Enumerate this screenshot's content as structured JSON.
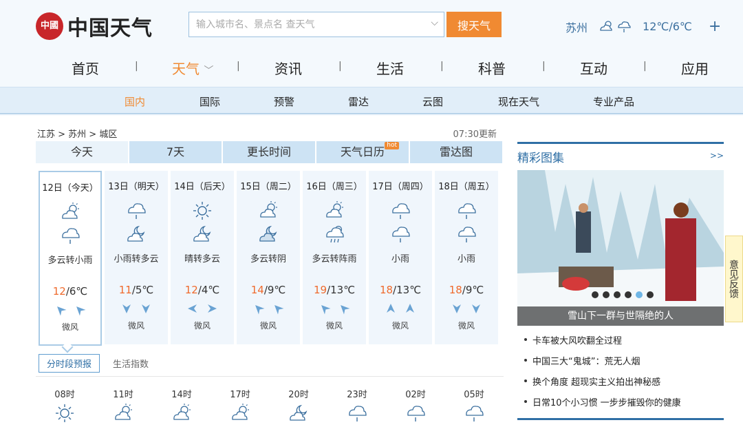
{
  "logo": {
    "seal": "中國",
    "text": "中国天气"
  },
  "search": {
    "placeholder": "输入城市名、景点名 查天气",
    "button": "搜天气"
  },
  "current": {
    "city": "苏州",
    "temp": "12℃/6℃",
    "plus": "+"
  },
  "mainnav": [
    "首页",
    "天气",
    "资讯",
    "生活",
    "科普",
    "互动",
    "应用"
  ],
  "mainnav_active": "天气",
  "subnav": [
    "国内",
    "国际",
    "预警",
    "雷达",
    "云图",
    "现在天气",
    "专业产品"
  ],
  "breadcrumb": "江苏 > 苏州 > 城区",
  "updated": "07:30更新",
  "tabs": [
    {
      "label": "今天"
    },
    {
      "label": "7天"
    },
    {
      "label": "更长时间"
    },
    {
      "label": "天气日历",
      "badge": "hot"
    },
    {
      "label": "雷达图"
    }
  ],
  "days": [
    {
      "date": "12日（今天）",
      "desc": "多云转小雨",
      "hi": "12",
      "lo": "/6℃",
      "wind": "微风",
      "icons": [
        "partly-cloudy-icon",
        "rain-icon"
      ]
    },
    {
      "date": "13日（明天）",
      "desc": "小雨转多云",
      "hi": "11",
      "lo": "/5℃",
      "wind": "微风",
      "icons": [
        "rain-icon",
        "partly-cloudy-night-icon"
      ]
    },
    {
      "date": "14日（后天）",
      "desc": "晴转多云",
      "hi": "12",
      "lo": "/4℃",
      "wind": "微风",
      "icons": [
        "sun-icon",
        "partly-cloudy-night-icon"
      ]
    },
    {
      "date": "15日（周二）",
      "desc": "多云转阴",
      "hi": "14",
      "lo": "/9℃",
      "wind": "微风",
      "icons": [
        "partly-cloudy-icon",
        "overcast-night-icon"
      ]
    },
    {
      "date": "16日（周三）",
      "desc": "多云转阵雨",
      "hi": "19",
      "lo": "/13℃",
      "wind": "微风",
      "icons": [
        "partly-cloudy-icon",
        "shower-icon"
      ]
    },
    {
      "date": "17日（周四）",
      "desc": "小雨",
      "hi": "18",
      "lo": "/13℃",
      "wind": "微风",
      "icons": [
        "rain-icon",
        "rain-icon"
      ]
    },
    {
      "date": "18日（周五）",
      "desc": "小雨",
      "hi": "18",
      "lo": "/9℃",
      "wind": "微风",
      "icons": [
        "rain-icon",
        "rain-icon"
      ]
    }
  ],
  "subtabs": [
    "分时段预报",
    "生活指数"
  ],
  "hours": [
    "08时",
    "11时",
    "14时",
    "17时",
    "20时",
    "23时",
    "02时",
    "05时"
  ],
  "hour_icons": [
    "sun-icon",
    "partly-cloudy-icon",
    "partly-cloudy-icon",
    "partly-cloudy-icon",
    "partly-cloudy-night-icon",
    "rain-icon",
    "rain-icon",
    "rain-icon"
  ],
  "gallery": {
    "title": "精彩图集",
    "more": ">>",
    "caption": "雪山下一群与世隔绝的人"
  },
  "news": [
    "卡车被大风吹翻全过程",
    "中国三大“鬼城”：荒无人烟",
    "换个角度 超现实主义拍出神秘感",
    "日常10个小习惯 一步步摧毁你的健康"
  ],
  "feedback": "意见反馈",
  "colors": {
    "accent": "#f08a32",
    "brand_blue": "#2f6fa5",
    "temp_high": "#ef6a2c",
    "seal_red": "#c8262a"
  }
}
